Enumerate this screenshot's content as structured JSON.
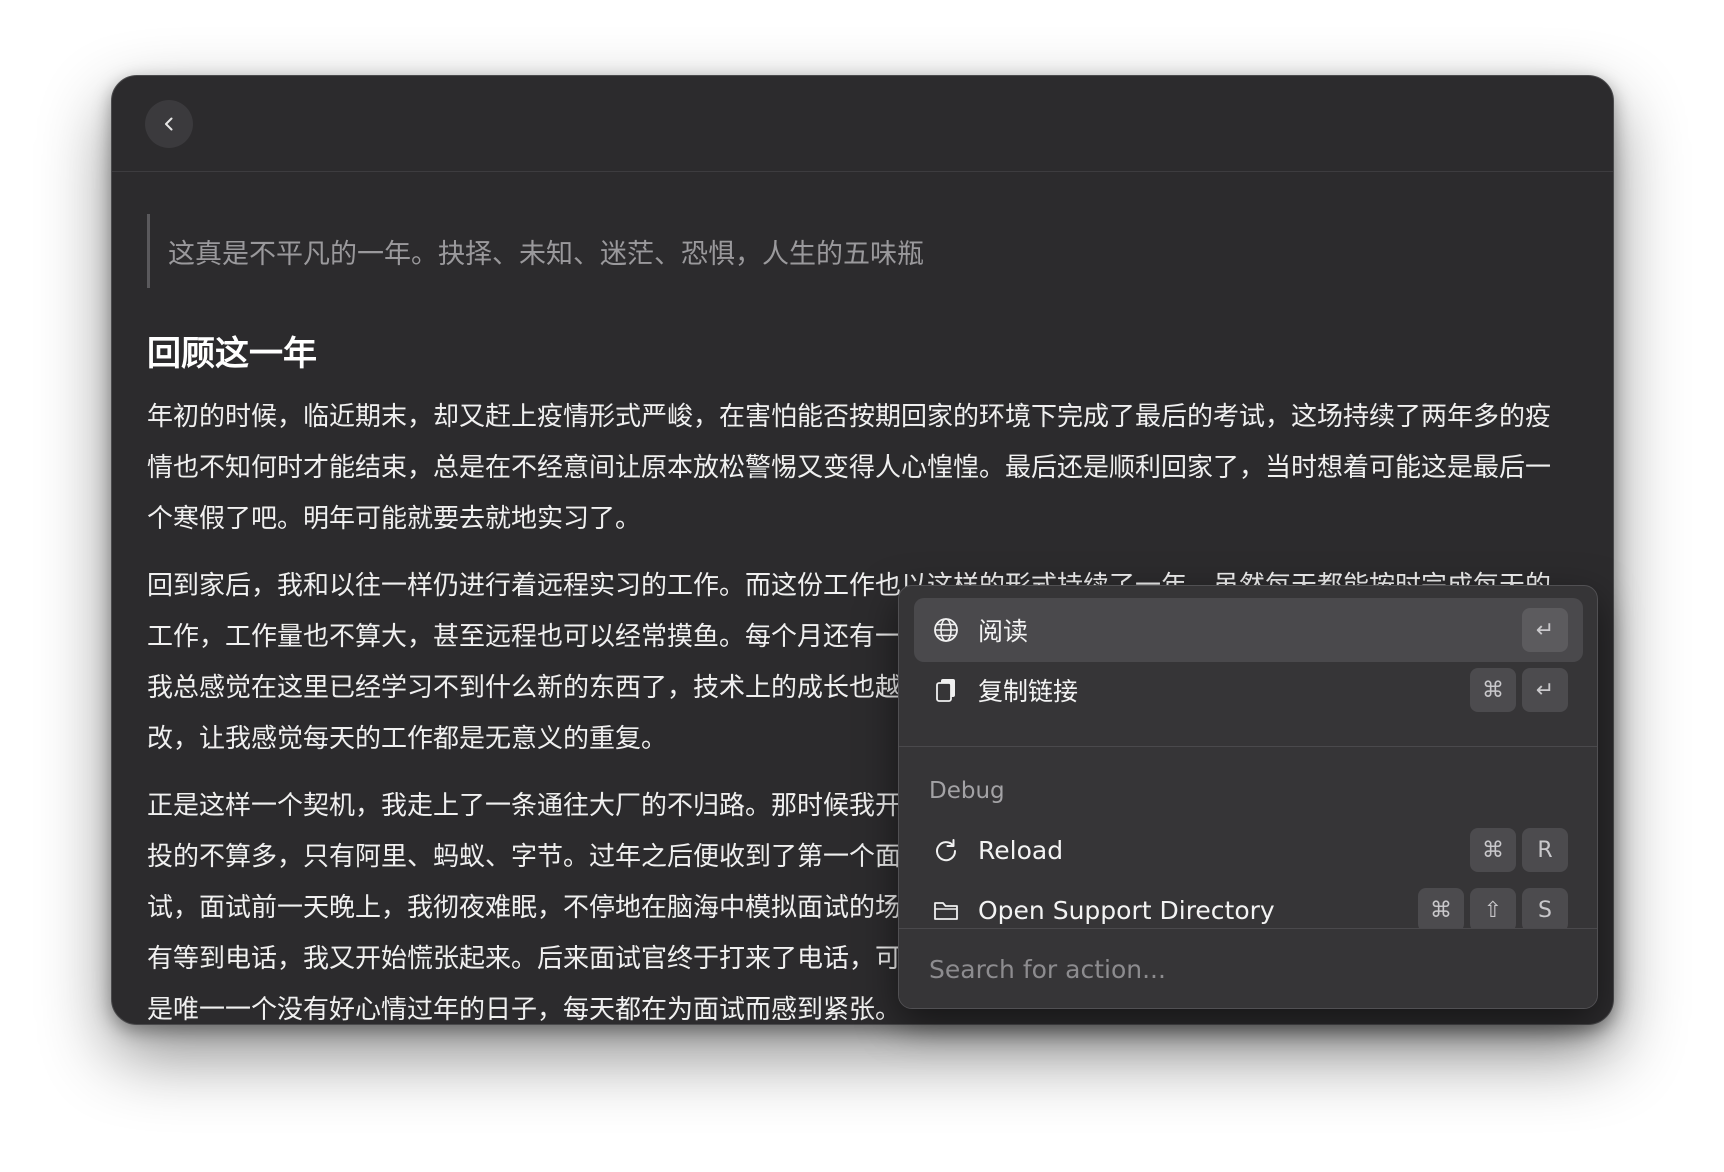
{
  "article": {
    "quote": "这真是不平凡的一年。抉择、未知、迷茫、恐惧，人生的五味瓶",
    "heading": "回顾这一年",
    "paragraphs": [
      "年初的时候，临近期末，却又赶上疫情形式严峻，在害怕能否按期回家的环境下完成了最后的考试，这场持续了两年多的疫情也不知何时才能结束，总是在不经意间让原本放松警惕又变得人心惶惶。最后还是顺利回家了，当时想着可能这是最后一个寒假了吧。明年可能就要去就地实习了。",
      "回到家后，我和以往一样仍进行着远程实习的工作。而这份工作也以这样的形式持续了一年，虽然每天都能按时完成每天的工作，工作量也不算大，甚至远程也可以经常摸鱼。每个月还有一份不错的收入，对于学生来说已是不少的钱。即便这样，我总感觉在这里已经学习不到什么新的东西了，技术上的成长也越来越少，每天的工作都只是在不停试错，一个需求频繁改，让我感觉每天的工作都是无意义的重复。",
      "正是这样一个契机，我走上了一条通往大厂的不归路。那时候我开始刷题、复习八股文，准备投递了一些大厂的暑期实习，投的不算多，只有阿里、蚂蚁、字节。过年之后便收到了第一个面试邀请，时间定在了开学第一个工作周。那是我第一次面试，面试前一天晚上，我彻夜难眠，不停地在脑海中模拟面试的场景。第二天我一整天都坐立难安，等到了约定的时间却没有等到电话，我又开始慌张起来。后来面试官终于打来了电话，可惜由于面试经验以及准备仍不充分，最后以失败告终。这是唯一一个没有好心情过年的日子，每天都在为面试而感到紧张。"
    ]
  },
  "actions": {
    "items": [
      {
        "label": "阅读",
        "icon": "globe-icon",
        "keys": [
          "↵"
        ]
      },
      {
        "label": "复制链接",
        "icon": "copy-icon",
        "keys": [
          "⌘",
          "↵"
        ]
      }
    ],
    "section": "Debug",
    "debug_items": [
      {
        "label": "Reload",
        "icon": "reload-icon",
        "keys": [
          "⌘",
          "R"
        ]
      },
      {
        "label": "Open Support Directory",
        "icon": "folder-icon",
        "keys": [
          "⌘",
          "⇧",
          "S"
        ]
      }
    ],
    "search_placeholder": "Search for action..."
  }
}
